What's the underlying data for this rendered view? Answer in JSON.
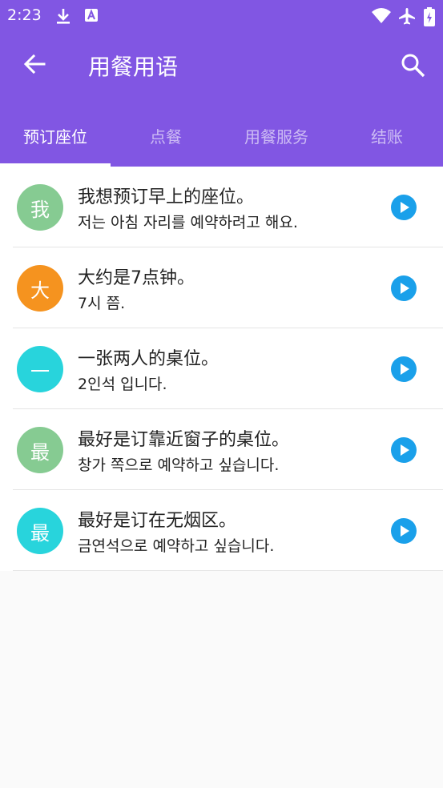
{
  "status_bar": {
    "time": "2:23",
    "icons": [
      "download-icon",
      "a-notification-icon",
      "wifi-icon",
      "airplane-mode-icon",
      "battery-charging-icon"
    ]
  },
  "toolbar": {
    "title": "用餐用语",
    "back_icon": "arrow-back-icon",
    "search_icon": "search-icon"
  },
  "tabs": [
    {
      "label": "预订座位",
      "active": true
    },
    {
      "label": "点餐",
      "active": false
    },
    {
      "label": "用餐服务",
      "active": false
    },
    {
      "label": "结账",
      "active": false
    }
  ],
  "items": [
    {
      "avatar": "我",
      "avatar_color": "#86cb92",
      "cn": "我想预订早上的座位。",
      "ko": "저는 아침 자리를 예약하려고 해요."
    },
    {
      "avatar": "大",
      "avatar_color": "#f5931f",
      "cn": "大约是7点钟。",
      "ko": "7시 쯤."
    },
    {
      "avatar": "一",
      "avatar_color": "#28d4dc",
      "cn": "一张两人的桌位。",
      "ko": "2인석 입니다."
    },
    {
      "avatar": "最",
      "avatar_color": "#86cb92",
      "cn": "最好是订靠近窗子的桌位。",
      "ko": "창가 쪽으로 예약하고 싶습니다."
    },
    {
      "avatar": "最",
      "avatar_color": "#28d4dc",
      "cn": "最好是订在无烟区。",
      "ko": "금연석으로 예약하고 싶습니다."
    }
  ],
  "colors": {
    "app_bar": "#8156e3",
    "play_button": "#1aa0ea"
  }
}
